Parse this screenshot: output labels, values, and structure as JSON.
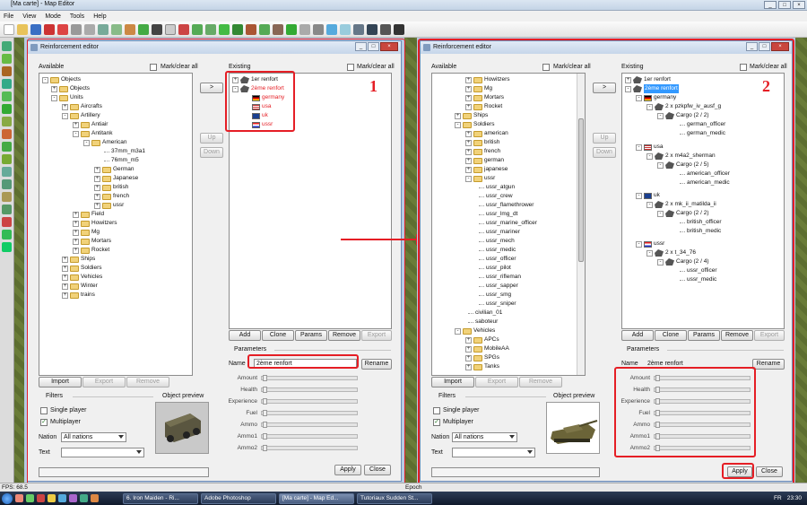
{
  "app": {
    "title": "[Ma carte] - Map Editor",
    "menu": [
      "File",
      "View",
      "Mode",
      "Tools",
      "Help"
    ],
    "status_fps": "FPS: 68.5",
    "status_epoch": "Epoch"
  },
  "taskbar": {
    "items": [
      "6. Iron Maiden - Ri...",
      "Adobe Photoshop",
      "[Ma carte] - Map Ed...",
      "Tutoriaux Sudden St..."
    ],
    "lang": "FR",
    "time": "23:30"
  },
  "dialog": {
    "title": "Reinforcement editor",
    "available_label": "Available",
    "mark_clear": "Mark/clear all",
    "existing_label": "Existing",
    "buttons": {
      "move": ">",
      "up": "Up",
      "down": "Down",
      "add": "Add",
      "clone": "Clone",
      "params": "Params",
      "remove": "Remove",
      "export": "Export",
      "import": "Import",
      "rename": "Rename",
      "apply": "Apply",
      "close": "Close"
    },
    "parameters_label": "Parameters",
    "name_label": "Name",
    "name_value": "2ème renfort",
    "params": [
      "Amount",
      "Health",
      "Experience",
      "Fuel",
      "Ammo",
      "Ammo1",
      "Ammo2"
    ],
    "filters_label": "Filters",
    "single_player": "Single player",
    "multiplayer": "Multiplayer",
    "nation_label": "Nation",
    "nation_value": "All nations",
    "text_label": "Text",
    "object_preview": "Object preview"
  },
  "left": {
    "available_tree": [
      "Objects",
      "Objects",
      "Units",
      "Aircrafts",
      "Artillery",
      "Antiair",
      "Antitank",
      "American",
      "37mm_m3a1",
      "76mm_m5",
      "German",
      "Japanese",
      "british",
      "french",
      "ussr",
      "Field",
      "Howitzers",
      "Mg",
      "Mortars",
      "Rocket",
      "Ships",
      "Soldiers",
      "Vehicles",
      "Winter",
      "trains"
    ],
    "existing_tree": [
      "1er renfort",
      "2ème renfort",
      "germany",
      "usa",
      "uk",
      "ussr"
    ],
    "callout": "1"
  },
  "right": {
    "available_tree": [
      "Howitzers",
      "Mg",
      "Mortars",
      "Rocket",
      "Ships",
      "Soldiers",
      "american",
      "british",
      "french",
      "german",
      "japanese",
      "ussr",
      "ussr_atgun",
      "ussr_crew",
      "ussr_flamethrower",
      "ussr_lmg_dt",
      "ussr_marine_officer",
      "ussr_mariner",
      "ussr_mech",
      "ussr_medic",
      "ussr_officer",
      "ussr_pilot",
      "ussr_rifleman",
      "ussr_sapper",
      "ussr_smg",
      "ussr_sniper",
      "civilian_01",
      "saboteur",
      "Vehicles",
      "APCs",
      "MobileAA",
      "SPGs",
      "Tanks"
    ],
    "existing_tree": [
      "1er renfort",
      "2ème renfort",
      "germany",
      "2 x pzkpfw_iv_ausf_g",
      "Cargo (2 / 2)",
      "german_officer",
      "german_medic",
      "usa",
      "2 x m4a2_sherman",
      "Cargo (2 / 5)",
      "american_officer",
      "american_medic",
      "uk",
      "2 x mk_ii_matilda_ii",
      "Cargo (2 / 2)",
      "british_officer",
      "british_medic",
      "ussr",
      "2 x t_34_76",
      "Cargo (2 / 4)",
      "ussr_officer",
      "ussr_medic"
    ],
    "callout": "2"
  },
  "colors": {
    "accent_red": "#e51e25",
    "selection": "#3399ff"
  }
}
